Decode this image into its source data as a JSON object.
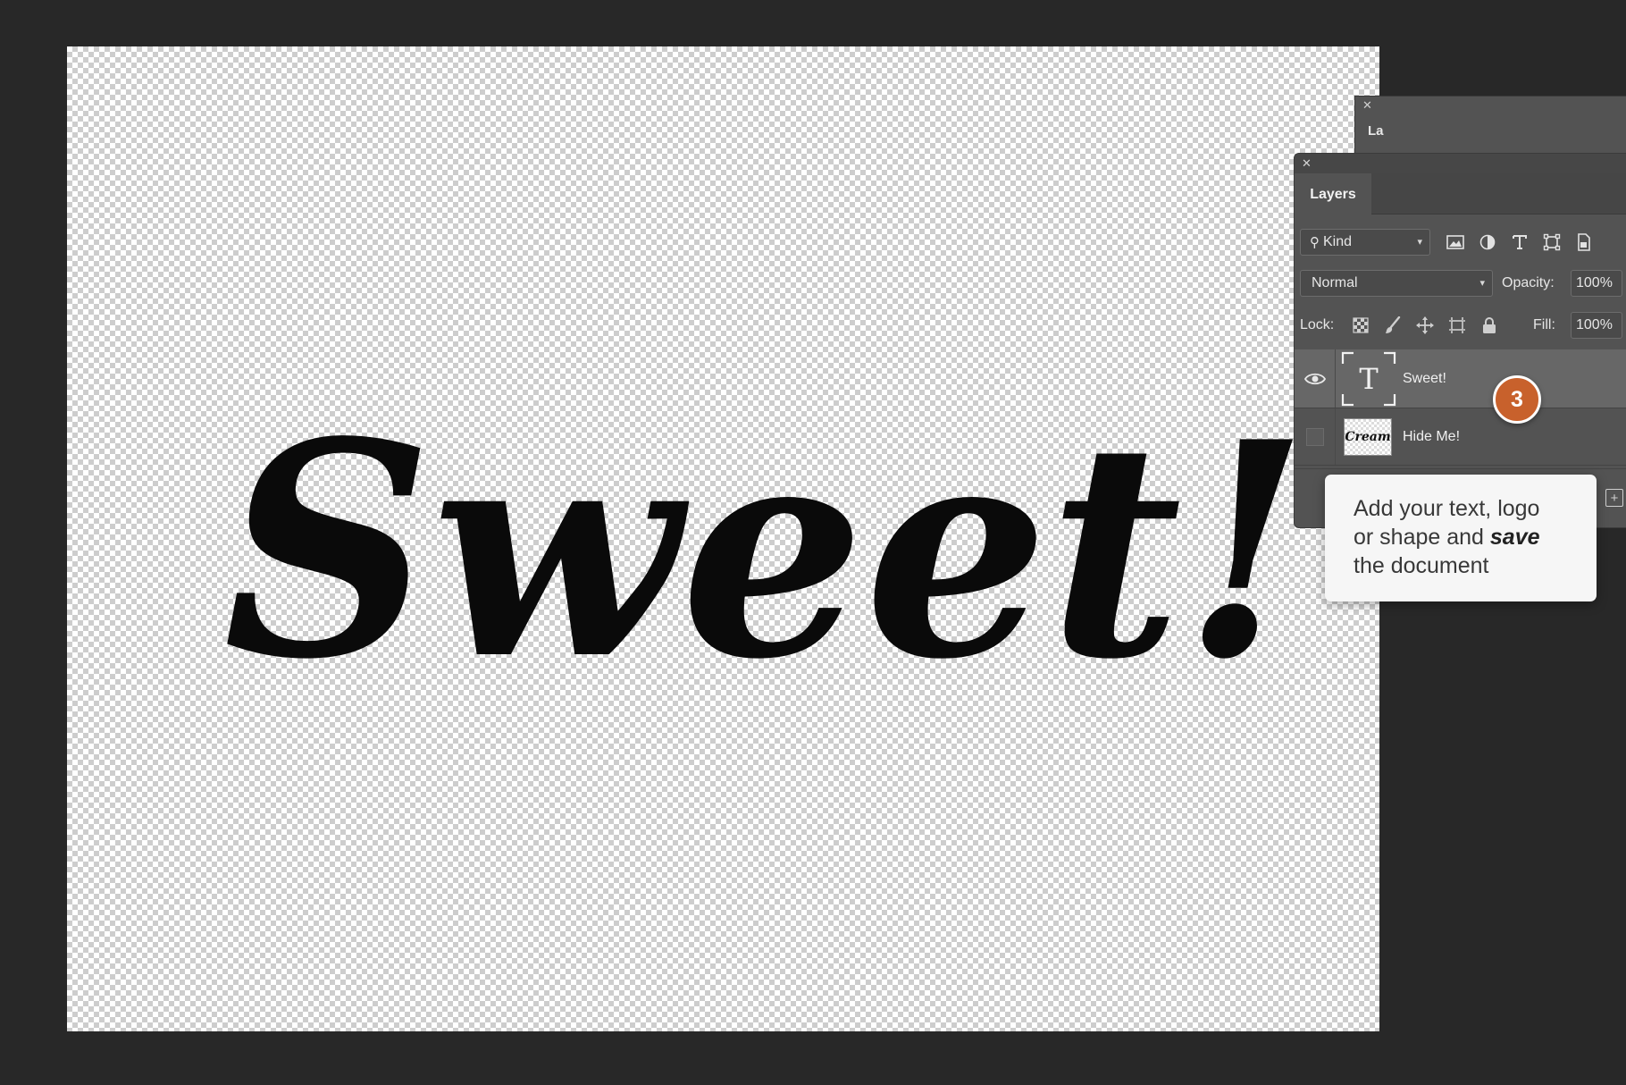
{
  "canvas": {
    "artwork_text": "Sweet!"
  },
  "back_panel": {
    "tab_fragment": "La"
  },
  "layers_panel": {
    "tab_label": "Layers",
    "filter": {
      "kind_label": "Kind",
      "icons": [
        "image-filter-icon",
        "adjustment-filter-icon",
        "type-filter-icon",
        "shape-filter-icon",
        "smart-object-filter-icon"
      ]
    },
    "blend_mode": "Normal",
    "opacity_label": "Opacity:",
    "opacity_value": "100%",
    "lock_label": "Lock:",
    "lock_icons": [
      "lock-transparent-pixels-icon",
      "lock-image-pixels-icon",
      "lock-position-icon",
      "lock-artboard-icon",
      "lock-all-icon"
    ],
    "fill_label": "Fill:",
    "fill_value": "100%",
    "layers": [
      {
        "name": "Sweet!",
        "type": "text",
        "thumb_glyph": "T",
        "visible": true,
        "selected": true
      },
      {
        "name": "Hide Me!",
        "type": "image",
        "thumb_text": "Cream",
        "visible": false,
        "selected": false
      }
    ]
  },
  "step_badge": {
    "number": "3",
    "color": "#c8612c"
  },
  "tooltip": {
    "line1": "Add your text, logo",
    "line2_prefix": "or shape and ",
    "line2_emphasis": "save",
    "line3": "the document"
  },
  "colors": {
    "workspace_bg": "#282828",
    "panel_bg": "#535353",
    "selected_row": "#676767",
    "accent": "#c8612c"
  }
}
